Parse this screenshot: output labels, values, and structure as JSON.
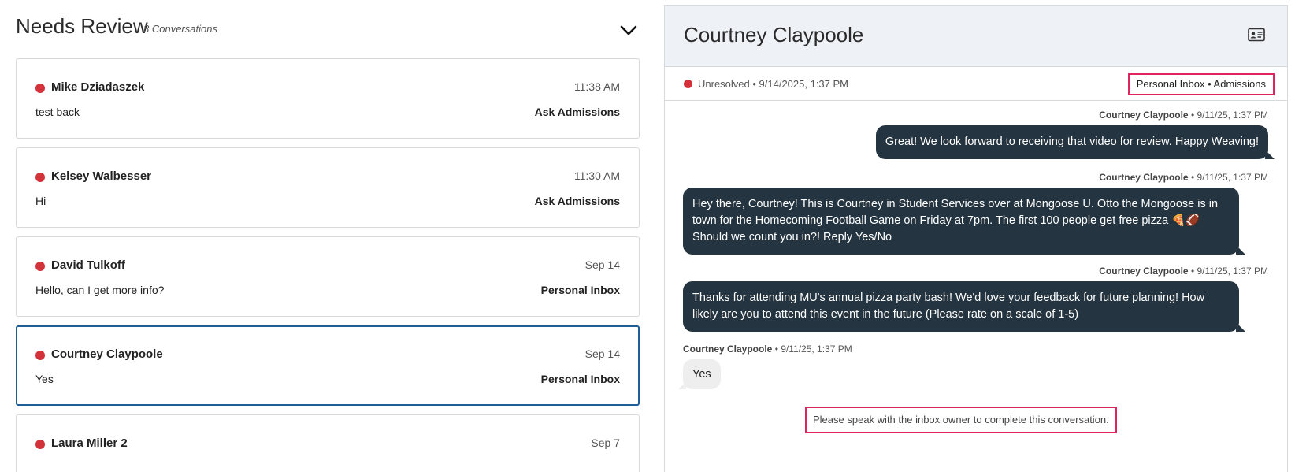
{
  "list": {
    "title": "Needs Review",
    "count": "8 Conversations",
    "conversations": [
      {
        "name": "Mike Dziadaszek",
        "time": "11:38 AM",
        "preview": "test back",
        "inbox": "Ask Admissions",
        "status_color": "#d2333b"
      },
      {
        "name": "Kelsey Walbesser",
        "time": "11:30 AM",
        "preview": "Hi",
        "inbox": "Ask Admissions",
        "status_color": "#d2333b"
      },
      {
        "name": "David Tulkoff",
        "time": "Sep 14",
        "preview": "Hello, can I get more info?",
        "inbox": "Personal Inbox",
        "status_color": "#d2333b"
      },
      {
        "name": "Courtney Claypoole",
        "time": "Sep 14",
        "preview": "Yes",
        "inbox": "Personal Inbox",
        "status_color": "#d2333b",
        "selected": true
      },
      {
        "name": "Laura Miller 2",
        "time": "Sep 7",
        "preview": "",
        "inbox": "",
        "status_color": "#d2333b"
      }
    ]
  },
  "detail": {
    "title": "Courtney Claypoole",
    "status": "Unresolved • 9/14/2025, 1:37 PM",
    "inbox_tag": "Personal Inbox • Admissions",
    "messages": [
      {
        "sender": "Courtney Claypoole",
        "timestamp": "• 9/11/25, 1:37 PM",
        "direction": "outgoing",
        "text": "Great! We look forward to receiving that video for review. Happy Weaving!"
      },
      {
        "sender": "Courtney Claypoole",
        "timestamp": "• 9/11/25, 1:37 PM",
        "direction": "outgoing",
        "text": "Hey there, Courtney! This is Courtney in Student Services over at Mongoose U. Otto the Mongoose is in town for the Homecoming Football Game on Friday at 7pm. The first 100 people get free pizza 🍕🏈 Should we count you in?! Reply Yes/No"
      },
      {
        "sender": "Courtney Claypoole",
        "timestamp": "• 9/11/25, 1:37 PM",
        "direction": "outgoing",
        "text": "Thanks for attending MU's annual pizza party bash! We'd love your feedback for future planning! How likely are you to attend this event in the future (Please rate on a scale of 1-5)"
      },
      {
        "sender": "Courtney Claypoole",
        "timestamp": "• 9/11/25, 1:37 PM",
        "direction": "incoming",
        "text": "Yes"
      }
    ],
    "notice": "Please speak with the inbox owner to complete this conversation."
  },
  "colors": {
    "unresolved_dot": "#d2333b",
    "outgoing_bubble": "#243440",
    "incoming_bubble": "#eeeeee",
    "selected_border": "#1f5f97",
    "highlight_border": "#e0245e",
    "header_bg": "#eef1f6"
  },
  "icons": {
    "collapse": "chevron-down-icon",
    "contact": "contact-card-icon",
    "status": "status-dot"
  }
}
